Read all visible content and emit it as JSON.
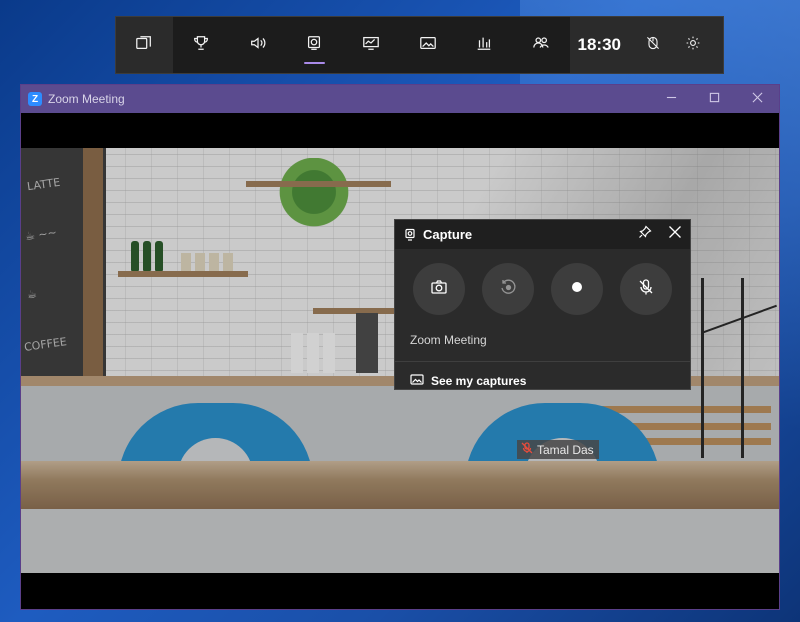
{
  "gamebar": {
    "buttons": [
      {
        "name": "widget-menu-icon"
      },
      {
        "name": "achievements-icon"
      },
      {
        "name": "audio-icon"
      },
      {
        "name": "capture-icon"
      },
      {
        "name": "performance-icon"
      },
      {
        "name": "gallery-icon"
      },
      {
        "name": "resources-icon"
      },
      {
        "name": "social-icon"
      }
    ],
    "active_index": 3,
    "time": "18:30",
    "accent": "#a98ae8"
  },
  "zoom_window": {
    "title": "Zoom Meeting",
    "participant_name": "Tamal Das",
    "title_color": "#5b4b8f"
  },
  "capture_widget": {
    "title": "Capture",
    "app_name": "Zoom Meeting",
    "see_captures_label": "See my captures",
    "buttons": [
      "screenshot-icon",
      "record-last-30s-icon",
      "start-recording-icon",
      "microphone-off-icon"
    ]
  }
}
